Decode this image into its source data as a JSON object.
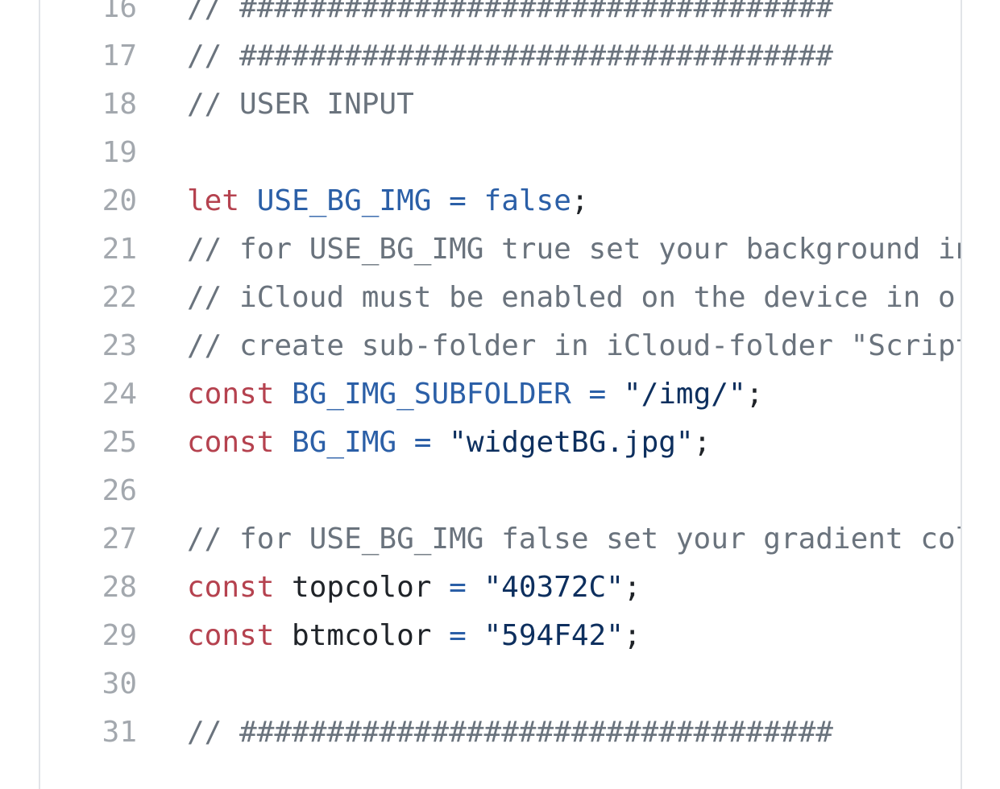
{
  "editor": {
    "lines": [
      {
        "number": "16",
        "tokens": [
          {
            "type": "comment",
            "text": "// ##################################"
          }
        ]
      },
      {
        "number": "17",
        "tokens": [
          {
            "type": "comment",
            "text": "// ##################################"
          }
        ]
      },
      {
        "number": "18",
        "tokens": [
          {
            "type": "comment",
            "text": "// USER INPUT"
          }
        ]
      },
      {
        "number": "19",
        "tokens": []
      },
      {
        "number": "20",
        "tokens": [
          {
            "type": "keyword",
            "text": "let"
          },
          {
            "type": "plain",
            "text": " "
          },
          {
            "type": "ident",
            "text": "USE_BG_IMG"
          },
          {
            "type": "plain",
            "text": " "
          },
          {
            "type": "op",
            "text": "="
          },
          {
            "type": "plain",
            "text": " "
          },
          {
            "type": "ident",
            "text": "false"
          },
          {
            "type": "plain",
            "text": ";"
          }
        ]
      },
      {
        "number": "21",
        "tokens": [
          {
            "type": "comment",
            "text": "// for USE_BG_IMG true set your background in"
          }
        ]
      },
      {
        "number": "22",
        "tokens": [
          {
            "type": "comment",
            "text": "// iCloud must be enabled on the device in or"
          }
        ]
      },
      {
        "number": "23",
        "tokens": [
          {
            "type": "comment",
            "text": "// create sub-folder in iCloud-folder \"Script"
          }
        ]
      },
      {
        "number": "24",
        "tokens": [
          {
            "type": "keyword",
            "text": "const"
          },
          {
            "type": "plain",
            "text": " "
          },
          {
            "type": "ident",
            "text": "BG_IMG_SUBFOLDER"
          },
          {
            "type": "plain",
            "text": " "
          },
          {
            "type": "op",
            "text": "="
          },
          {
            "type": "plain",
            "text": " "
          },
          {
            "type": "string",
            "text": "\"/img/\""
          },
          {
            "type": "plain",
            "text": ";"
          }
        ]
      },
      {
        "number": "25",
        "tokens": [
          {
            "type": "keyword",
            "text": "const"
          },
          {
            "type": "plain",
            "text": " "
          },
          {
            "type": "ident",
            "text": "BG_IMG"
          },
          {
            "type": "plain",
            "text": " "
          },
          {
            "type": "op",
            "text": "="
          },
          {
            "type": "plain",
            "text": " "
          },
          {
            "type": "string",
            "text": "\"widgetBG.jpg\""
          },
          {
            "type": "plain",
            "text": ";"
          }
        ]
      },
      {
        "number": "26",
        "tokens": []
      },
      {
        "number": "27",
        "tokens": [
          {
            "type": "comment",
            "text": "// for USE_BG_IMG false set your gradient col"
          }
        ]
      },
      {
        "number": "28",
        "tokens": [
          {
            "type": "keyword",
            "text": "const"
          },
          {
            "type": "plain",
            "text": " topcolor "
          },
          {
            "type": "op",
            "text": "="
          },
          {
            "type": "plain",
            "text": " "
          },
          {
            "type": "string",
            "text": "\"40372C\""
          },
          {
            "type": "plain",
            "text": ";"
          }
        ]
      },
      {
        "number": "29",
        "tokens": [
          {
            "type": "keyword",
            "text": "const"
          },
          {
            "type": "plain",
            "text": " btmcolor "
          },
          {
            "type": "op",
            "text": "="
          },
          {
            "type": "plain",
            "text": " "
          },
          {
            "type": "string",
            "text": "\"594F42\""
          },
          {
            "type": "plain",
            "text": ";"
          }
        ]
      },
      {
        "number": "30",
        "tokens": []
      },
      {
        "number": "31",
        "tokens": [
          {
            "type": "comment",
            "text": "// ##################################"
          }
        ]
      }
    ]
  },
  "colors": {
    "comment": "#6a737d",
    "keyword": "#b5424f",
    "identifier": "#2b5fa7",
    "string": "#0d2f5e",
    "line_number": "#a3a8ae",
    "border": "#e1e4e8"
  }
}
